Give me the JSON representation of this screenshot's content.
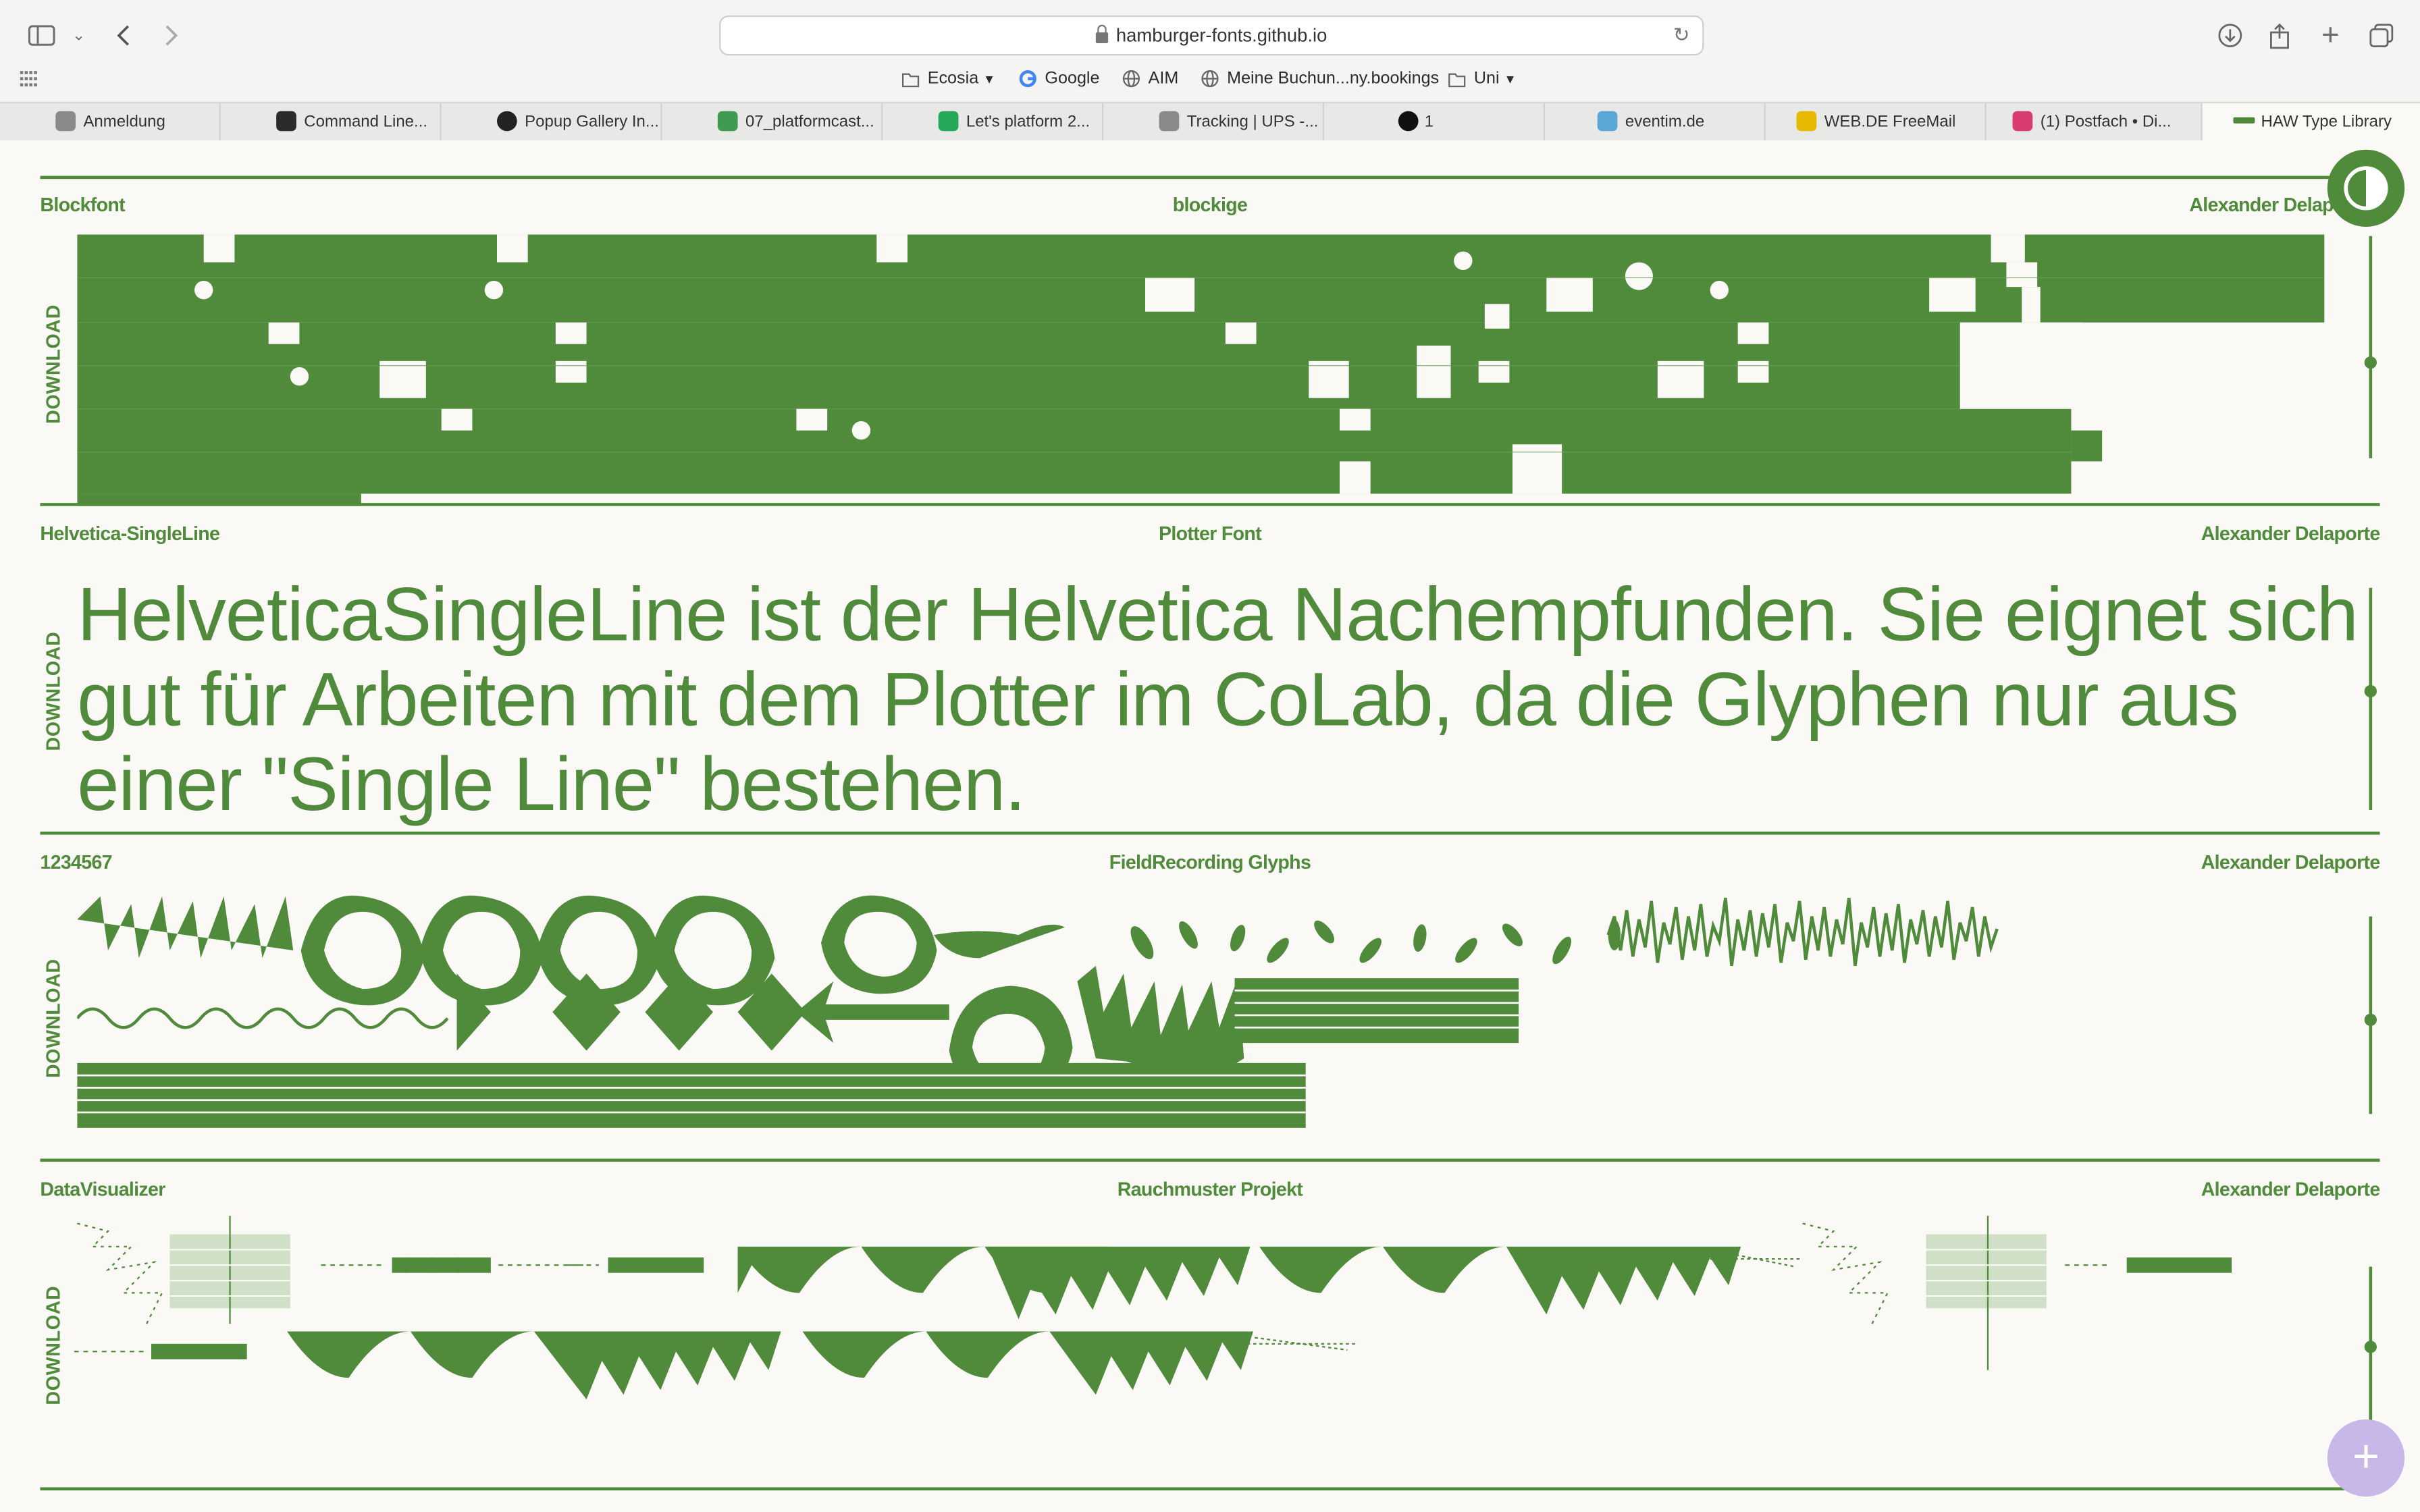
{
  "browser": {
    "url": "hamburger-fonts.github.io",
    "bookmarks": [
      {
        "label": "Ecosia",
        "icon": "folder-icon",
        "dropdown": true
      },
      {
        "label": "Google",
        "icon": "google-icon"
      },
      {
        "label": "AIM",
        "icon": "globe-icon"
      },
      {
        "label": "Meine Buchun...ny.bookings",
        "icon": "globe-icon"
      },
      {
        "label": "Uni",
        "icon": "folder-icon",
        "dropdown": true
      }
    ],
    "tabs": [
      {
        "label": "Anmeldung",
        "color": "#8a8a8a"
      },
      {
        "label": "Command Line...",
        "color": "#2b2b2b"
      },
      {
        "label": "Popup Gallery In...",
        "color": "#222222"
      },
      {
        "label": "07_platformcast...",
        "color": "#3e9b4f"
      },
      {
        "label": "Let's platform 2...",
        "color": "#26a85b"
      },
      {
        "label": "Tracking | UPS -...",
        "color": "#8a8a8a"
      },
      {
        "label": "1",
        "color": "#111111"
      },
      {
        "label": "eventim.de",
        "color": "#5aa7d6"
      },
      {
        "label": "WEB.DE FreeMail",
        "color": "#e6b800"
      },
      {
        "label": "(1) Postfach • Di...",
        "color": "#d93b73"
      },
      {
        "label": "HAW Type Library",
        "color": "#4f8b3b",
        "active": true
      }
    ]
  },
  "fonts": [
    {
      "name": "Blockfont",
      "tagline": "blockige",
      "author": "Alexander Delap",
      "download": "DOWNLOAD"
    },
    {
      "name": "Helvetica-SingleLine",
      "tagline": "Plotter Font",
      "author": "Alexander Delaporte",
      "download": "DOWNLOAD",
      "sample": "HelveticaSingleLine ist der Helvetica Nachempfunden. Sie eignet sich gut für Arbeiten mit dem Plotter im CoLab, da die Glyphen nur aus einer \"Single Line\" bestehen."
    },
    {
      "name": "1234567",
      "tagline": "FieldRecording Glyphs",
      "author": "Alexander Delaporte",
      "download": "DOWNLOAD"
    },
    {
      "name": "DataVisualizer",
      "tagline": "Rauchmuster Projekt",
      "author": "Alexander Delaporte",
      "download": "DOWNLOAD"
    }
  ],
  "colors": {
    "accent": "#4f8b3b",
    "background": "#faf9f5",
    "fab": "#c8b8e8"
  }
}
